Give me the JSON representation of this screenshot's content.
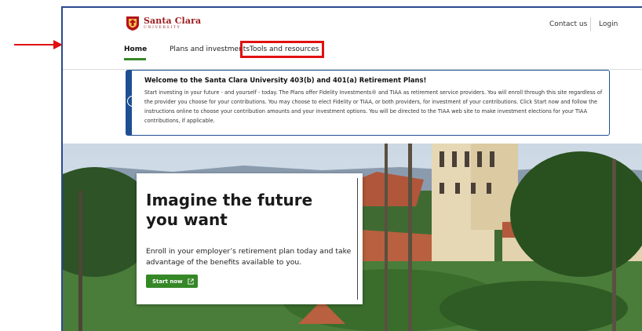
{
  "header": {
    "logo": {
      "name": "Santa Clara",
      "sub": "UNIVERSITY"
    },
    "contact_label": "Contact us",
    "login_label": "Login"
  },
  "nav": {
    "items": [
      {
        "label": "Home"
      },
      {
        "label": "Plans and investments"
      },
      {
        "label": "Tools and resources"
      }
    ]
  },
  "banner": {
    "title": "Welcome to the Santa Clara University 403(b) and 401(a) Retirement Plans!",
    "body": "Start investing in your future - and yourself - today. The Plans offer Fidelity Investments® and TIAA as retirement service providers. You will enroll through this site regardless of the provider you choose for your contributions. You may choose to elect Fidelity or TIAA, or both providers, for investment of your contributions. Click Start now and follow the instructions online to choose your contribution amounts and your investment options. You will be directed to the TIAA web site to make investment elections for your TIAA contributions, if applicable.",
    "icon": "info-icon"
  },
  "hero": {
    "title": "Imagine the future you want",
    "body": "Enroll in your employer’s retirement plan today and take advantage of the benefits available to you.",
    "button_label": "Start now",
    "button_icon": "external-link-icon"
  },
  "colors": {
    "accent_green": "#368727",
    "banner_blue": "#1d4f91",
    "brand_red": "#9b1b1b",
    "annotation_red": "#e01010"
  }
}
